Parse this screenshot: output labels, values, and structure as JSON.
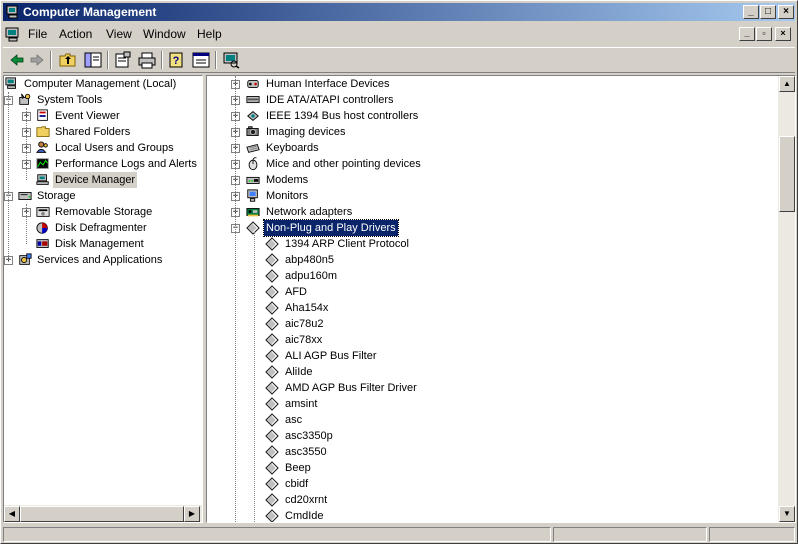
{
  "window": {
    "title": "Computer Management"
  },
  "menu": [
    "File",
    "Action",
    "View",
    "Window",
    "Help"
  ],
  "left_tree": [
    {
      "label": "Computer Management (Local)",
      "level": 0,
      "expander": "",
      "icon": "computer-icon"
    },
    {
      "label": "System Tools",
      "level": 1,
      "expander": "-",
      "icon": "tools-icon"
    },
    {
      "label": "Event Viewer",
      "level": 2,
      "expander": "+",
      "icon": "event-viewer-icon"
    },
    {
      "label": "Shared Folders",
      "level": 2,
      "expander": "+",
      "icon": "folder-icon"
    },
    {
      "label": "Local Users and Groups",
      "level": 2,
      "expander": "+",
      "icon": "users-icon"
    },
    {
      "label": "Performance Logs and Alerts",
      "level": 2,
      "expander": "+",
      "icon": "performance-icon"
    },
    {
      "label": "Device Manager",
      "level": 2,
      "expander": "",
      "icon": "device-manager-icon",
      "selected": true
    },
    {
      "label": "Storage",
      "level": 1,
      "expander": "-",
      "icon": "storage-icon"
    },
    {
      "label": "Removable Storage",
      "level": 2,
      "expander": "+",
      "icon": "removable-storage-icon"
    },
    {
      "label": "Disk Defragmenter",
      "level": 2,
      "expander": "",
      "icon": "defrag-icon"
    },
    {
      "label": "Disk Management",
      "level": 2,
      "expander": "",
      "icon": "disk-management-icon"
    },
    {
      "label": "Services and Applications",
      "level": 1,
      "expander": "+",
      "icon": "services-icon"
    }
  ],
  "device_categories": [
    {
      "label": "Human Interface Devices",
      "expander": "+",
      "icon": "hid-icon"
    },
    {
      "label": "IDE ATA/ATAPI controllers",
      "expander": "+",
      "icon": "ide-controller-icon"
    },
    {
      "label": "IEEE 1394 Bus host controllers",
      "expander": "+",
      "icon": "ieee1394-icon"
    },
    {
      "label": "Imaging devices",
      "expander": "+",
      "icon": "camera-icon"
    },
    {
      "label": "Keyboards",
      "expander": "+",
      "icon": "keyboard-icon"
    },
    {
      "label": "Mice and other pointing devices",
      "expander": "+",
      "icon": "mouse-icon"
    },
    {
      "label": "Modems",
      "expander": "+",
      "icon": "modem-icon"
    },
    {
      "label": "Monitors",
      "expander": "+",
      "icon": "monitor-icon"
    },
    {
      "label": "Network adapters",
      "expander": "+",
      "icon": "network-adapter-icon"
    },
    {
      "label": "Non-Plug and Play Drivers",
      "expander": "-",
      "icon": "driver-icon",
      "selected": true
    }
  ],
  "drivers": [
    "1394 ARP Client Protocol",
    "abp480n5",
    "adpu160m",
    "AFD",
    "Aha154x",
    "aic78u2",
    "aic78xx",
    "ALI AGP Bus Filter",
    "AliIde",
    "AMD AGP Bus Filter Driver",
    "amsint",
    "asc",
    "asc3350p",
    "asc3550",
    "Beep",
    "cbidf",
    "cd20xrnt",
    "CmdIde"
  ]
}
